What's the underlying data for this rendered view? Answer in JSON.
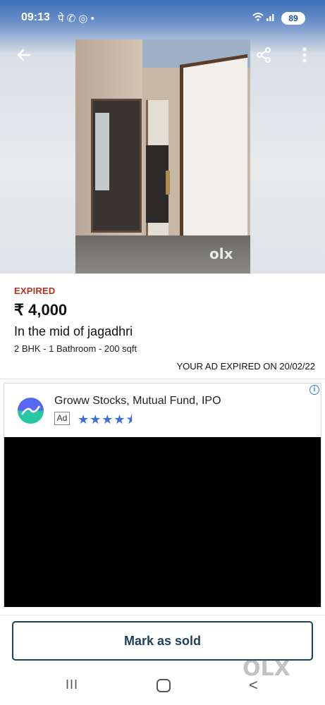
{
  "status_bar": {
    "time": "09:13",
    "notification_icons": "पे ✆ ◎ •",
    "battery": "89"
  },
  "hero": {
    "watermark": "olx"
  },
  "listing": {
    "status": "EXPIRED",
    "price": "₹ 4,000",
    "title": "In the mid of jagadhri",
    "details": "2 BHK - 1 Bathroom - 200 sqft",
    "expired_note": "YOUR AD EXPIRED ON 20/02/22"
  },
  "ad": {
    "title": "Groww Stocks, Mutual Fund, IPO",
    "tag": "Ad",
    "stars": "★★★★⯨",
    "info_icon": "i"
  },
  "actions": {
    "mark_sold_label": "Mark as sold"
  },
  "nav": {
    "recent": "III",
    "back": "<"
  },
  "colors": {
    "expired": "#b7321e",
    "button_border": "#1d3f5e",
    "star": "#3b6fe0"
  }
}
